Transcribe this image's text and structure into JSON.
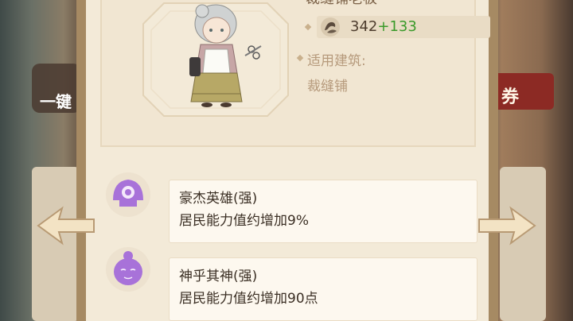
{
  "scene": {
    "left_label": "一键",
    "right_label": "券"
  },
  "character": {
    "name": "裁缝铺老板",
    "stat_base": "342",
    "stat_bonus": "+133",
    "applicable_label": "适用建筑:",
    "applicable_building": "裁缝铺"
  },
  "traits": [
    {
      "title": "豪杰英雄(强)",
      "description": "居民能力值约增加9%",
      "icon": "hero-helmet-icon"
    },
    {
      "title": "神乎其神(强)",
      "description": "居民能力值约增加90点",
      "icon": "buddha-face-icon"
    }
  ],
  "colors": {
    "accent": "#a070d8",
    "bonus": "#3a9a2a",
    "panel": "#f3ead8"
  }
}
